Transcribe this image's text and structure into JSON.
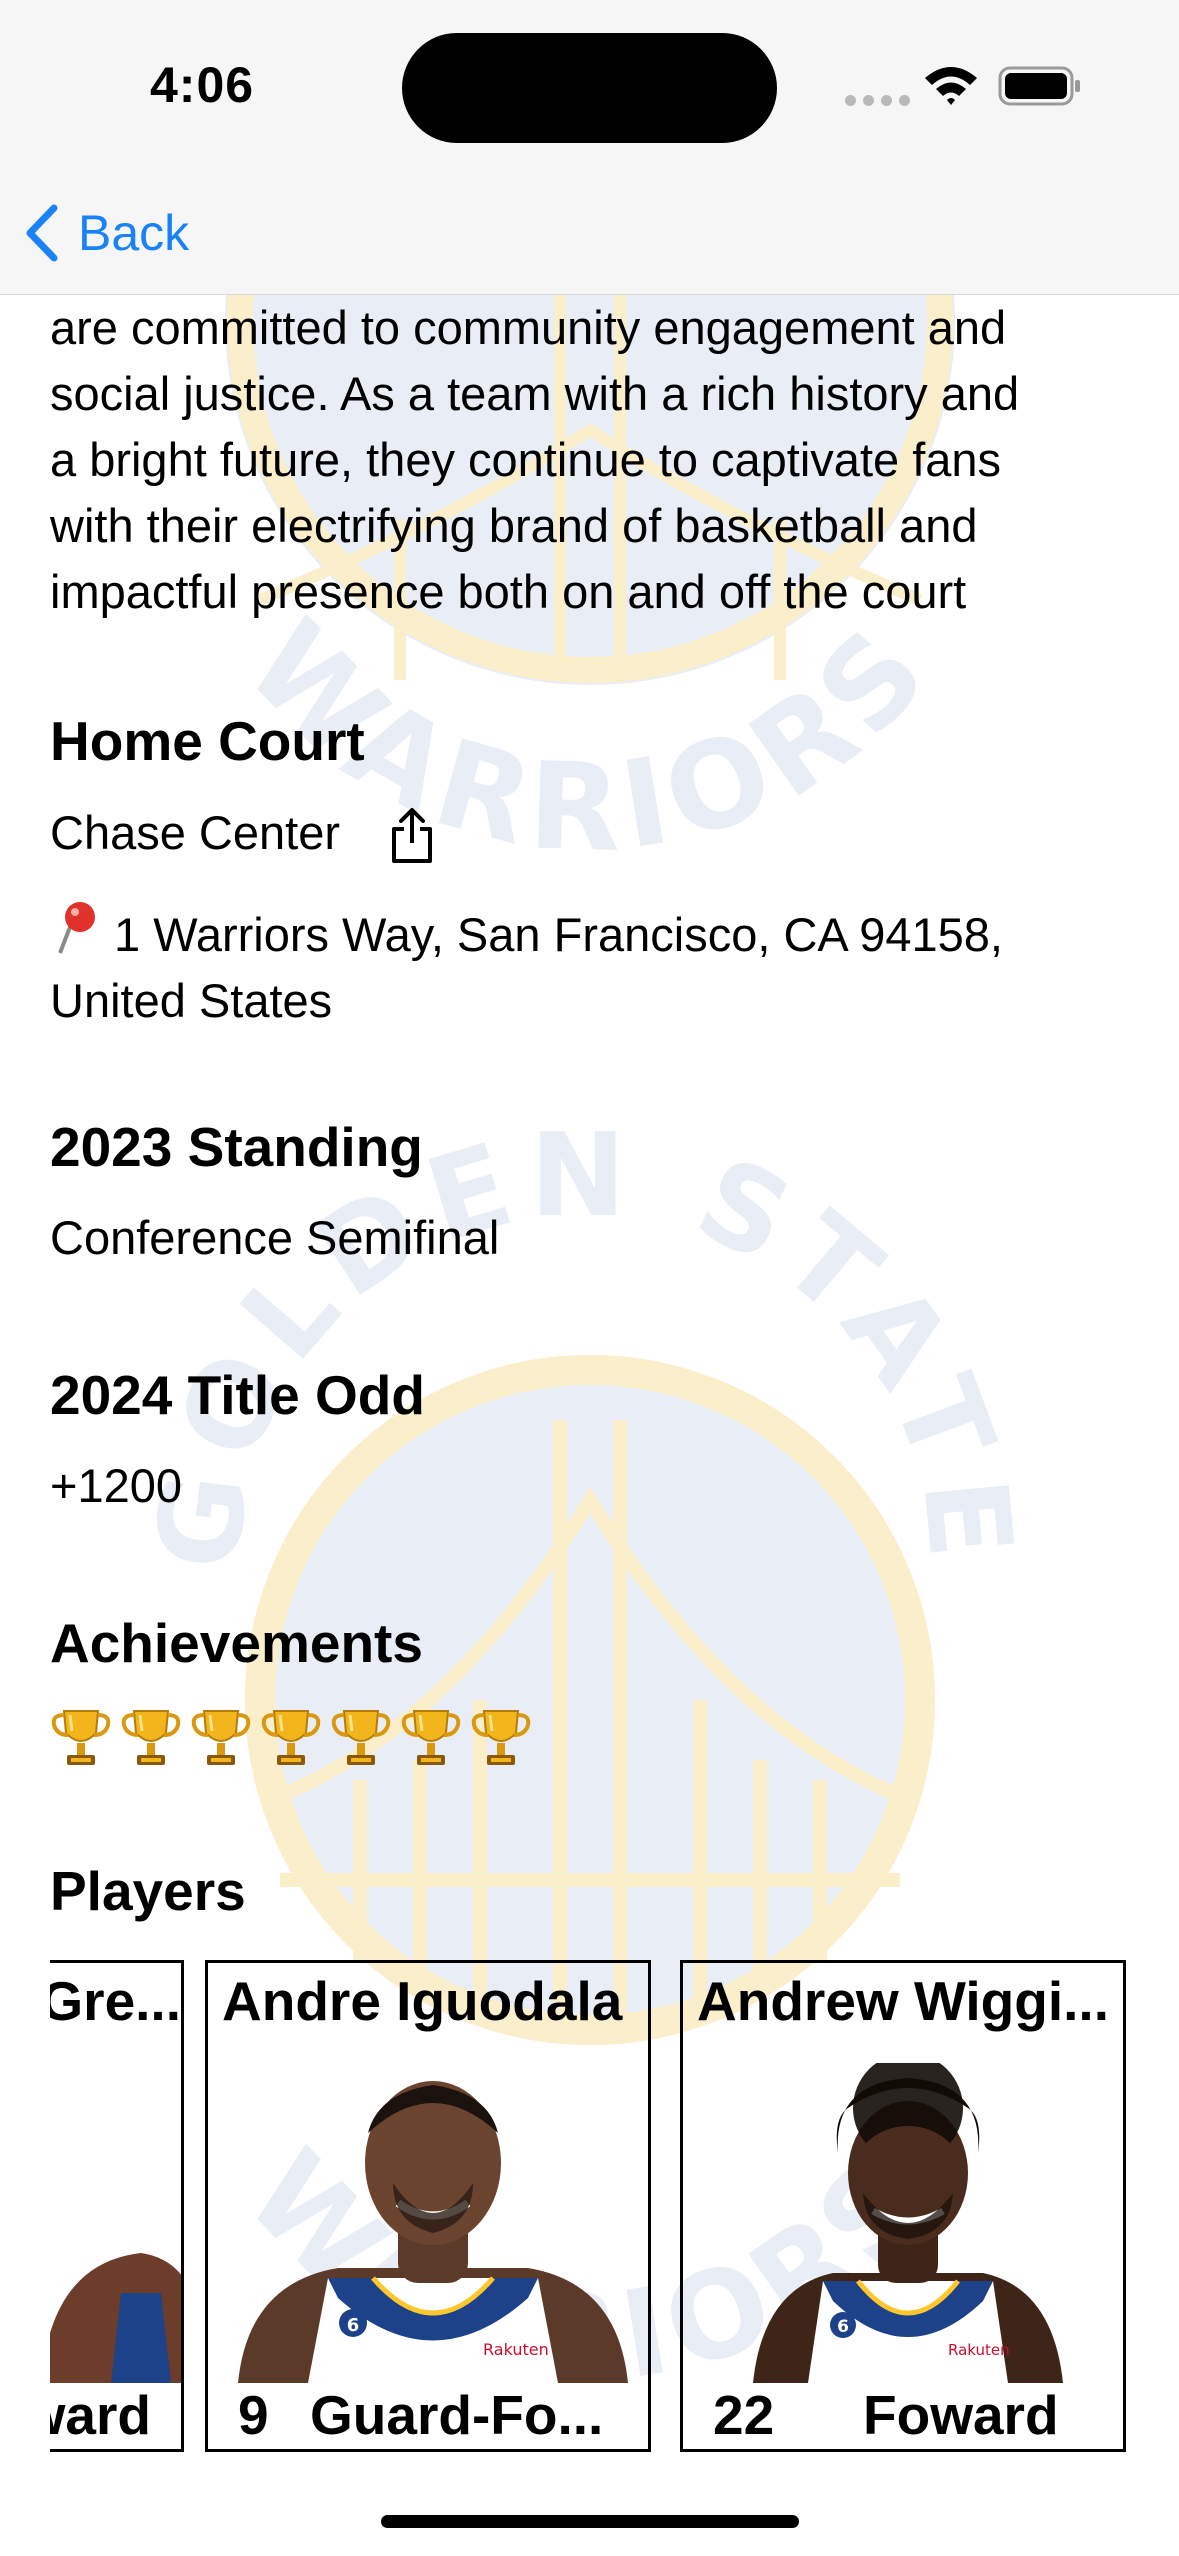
{
  "status_bar": {
    "time": "4:06"
  },
  "nav": {
    "back_label": "Back"
  },
  "description_lines": [
    "are committed to community engagement and",
    "social justice. As a team with a rich history and",
    "a bright future, they continue to captivate fans",
    "with their electrifying brand of basketball and",
    "impactful presence both on and off the court"
  ],
  "home_court": {
    "title": "Home Court",
    "arena": "Chase Center",
    "address_line1": "1 Warriors Way, San Francisco, CA 94158,",
    "address_line2": "United States"
  },
  "standing": {
    "title": "2023 Standing",
    "value": "Conference Semifinal"
  },
  "title_odd": {
    "title": "2024 Title Odd",
    "value": "+1200"
  },
  "achievements": {
    "title": "Achievements",
    "trophy_count": 7,
    "trophy_icon": "trophy-icon"
  },
  "players": {
    "title": "Players",
    "cards": [
      {
        "name": "Draymond Gre...",
        "number": "",
        "position": "Foward"
      },
      {
        "name": "Andre Iguodala",
        "number": "9",
        "position": "Guard-Fo..."
      },
      {
        "name": "Andrew Wiggi...",
        "number": "22",
        "position": "Foward"
      }
    ]
  },
  "watermark": {
    "top_text": "WARRIORS",
    "arc_text": "GOLDEN STATE",
    "bottom_text": "WARRIORS"
  },
  "colors": {
    "accent": "#1a82f7",
    "watermark_blue": "#e8edf6",
    "watermark_gold": "#fbeecb"
  }
}
